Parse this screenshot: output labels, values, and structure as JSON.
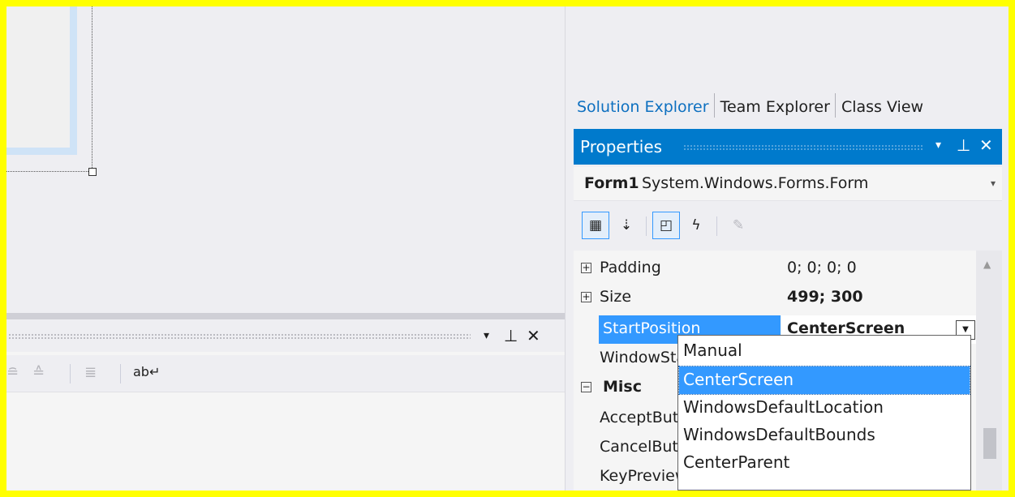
{
  "output_panel": {
    "window_controls": {
      "dropdown": "▾",
      "pin": "ᵩ",
      "close": "✕"
    },
    "toolbar_icons": [
      "align-left-icon",
      "align-right-icon",
      "outdent-icon",
      "word-wrap-icon"
    ]
  },
  "tool_tabs": [
    "Solution Explorer",
    "Team Explorer",
    "Class View"
  ],
  "properties": {
    "title": "Properties",
    "window_controls": {
      "dropdown": "▾",
      "pin": "ᵩ",
      "close": "✕"
    },
    "object_name": "Form1",
    "object_type": "System.Windows.Forms.Form",
    "rows": [
      {
        "name": "Padding",
        "value": "0; 0; 0; 0",
        "expandable": true
      },
      {
        "name": "Size",
        "value": "499; 300",
        "expandable": true
      },
      {
        "name": "StartPosition",
        "value": "CenterScreen",
        "selected": true
      },
      {
        "name": "WindowState",
        "value": ""
      },
      {
        "name": "Misc",
        "category": true
      },
      {
        "name": "AcceptButton",
        "value": ""
      },
      {
        "name": "CancelButton",
        "value": ""
      },
      {
        "name": "KeyPreview",
        "value": ""
      }
    ]
  },
  "start_position_dropdown": {
    "options": [
      "Manual",
      "CenterScreen",
      "WindowsDefaultLocation",
      "WindowsDefaultBounds",
      "CenterParent"
    ],
    "selected": "CenterScreen"
  },
  "colors": {
    "accent": "#007acc",
    "selection": "#3399ff",
    "frame": "#ffff00"
  }
}
